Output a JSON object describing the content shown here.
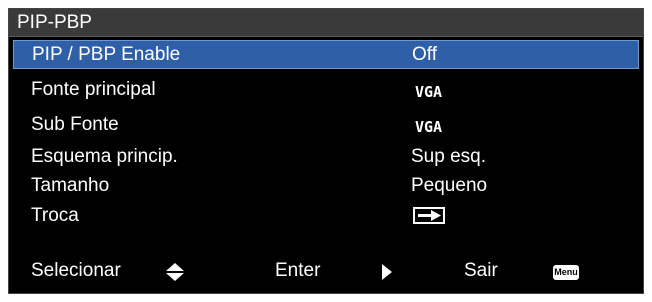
{
  "title": "PIP-PBP",
  "rows": [
    {
      "label": "PIP / PBP Enable",
      "value": "Off"
    },
    {
      "label": "Fonte principal",
      "value": "VGA"
    },
    {
      "label": "Sub Fonte",
      "value": "VGA"
    },
    {
      "label": "Esquema princip.",
      "value": "Sup esq."
    },
    {
      "label": "Tamanho",
      "value": "Pequeno"
    },
    {
      "label": "Troca",
      "value_icon": "swap-arrow-icon"
    }
  ],
  "footer": {
    "select_label": "Selecionar",
    "select_icon": "up-down-arrows-icon",
    "enter_label": "Enter",
    "enter_icon": "right-triangle-icon",
    "exit_label": "Sair",
    "menu_key": "Menu"
  },
  "colors": {
    "background": "#000000",
    "title_bar": "#3a3a3a",
    "selection": "#2f5fa6",
    "text": "#ffffff"
  }
}
